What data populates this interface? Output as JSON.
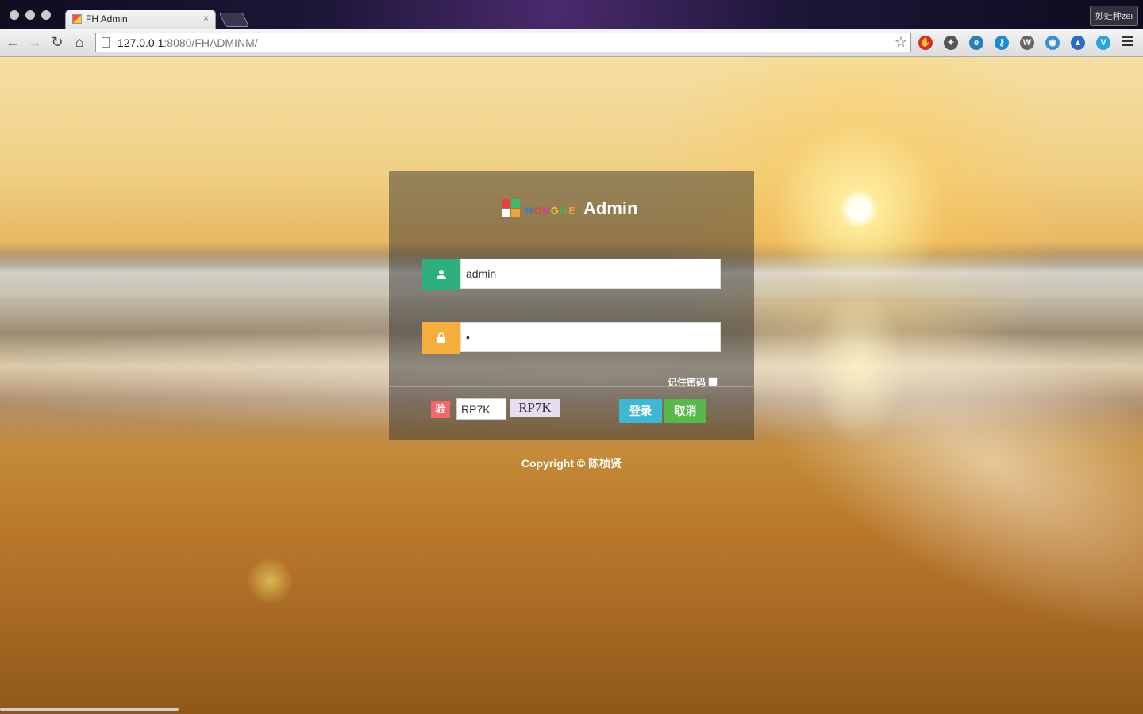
{
  "browser": {
    "tab_title": "FH Admin",
    "tab_close": "×",
    "url_host": "127.0.0.1",
    "url_rest": ":8080/FHADMINM/",
    "profile_name": "妙蛙种zei",
    "back_icon": "arrow-left",
    "forward_icon": "arrow-right",
    "reload_icon": "reload",
    "home_icon": "home",
    "bookmark_icon": "star"
  },
  "extensions": [
    {
      "name": "adblock-icon",
      "color": "#d52b2b",
      "glyph": "✋"
    },
    {
      "name": "satellite-icon",
      "color": "#555555",
      "glyph": "✦"
    },
    {
      "name": "e-icon",
      "color": "#2a7fb8",
      "glyph": "e"
    },
    {
      "name": "key-icon",
      "color": "#1c8ad6",
      "glyph": "⚷"
    },
    {
      "name": "w-icon",
      "color": "#666666",
      "glyph": "W"
    },
    {
      "name": "camera-icon",
      "color": "#3d8fd1",
      "glyph": "◉"
    },
    {
      "name": "graduate-cap-icon",
      "color": "#2d6cc0",
      "glyph": "▲"
    },
    {
      "name": "v-icon",
      "color": "#2aa4e0",
      "glyph": "V"
    }
  ],
  "login": {
    "logo_letters": [
      {
        "char": "H",
        "color": "#2e7fd0"
      },
      {
        "char": "O",
        "color": "#e8413c"
      },
      {
        "char": "N",
        "color": "#d93b9d"
      },
      {
        "char": "G",
        "color": "#f3c43b"
      },
      {
        "char": "G",
        "color": "#3eb86a"
      },
      {
        "char": "E",
        "color": "#f39c2e"
      }
    ],
    "logo_title": "Admin",
    "logo_colors": [
      "#e8413c",
      "#3eb86a",
      "#ffffff",
      "#f3a33a"
    ],
    "username_value": "admin",
    "password_value": "•",
    "user_addon_color": "#2db07d",
    "lock_addon_color": "#f5ae3c",
    "remember_label": "记住密码",
    "captcha_badge": "验",
    "captcha_value": "RP7K",
    "captcha_image_text": "RP7K",
    "login_button": "登录",
    "cancel_button": "取消"
  },
  "footer": {
    "copyright": "Copyright © 陈桢贤"
  }
}
